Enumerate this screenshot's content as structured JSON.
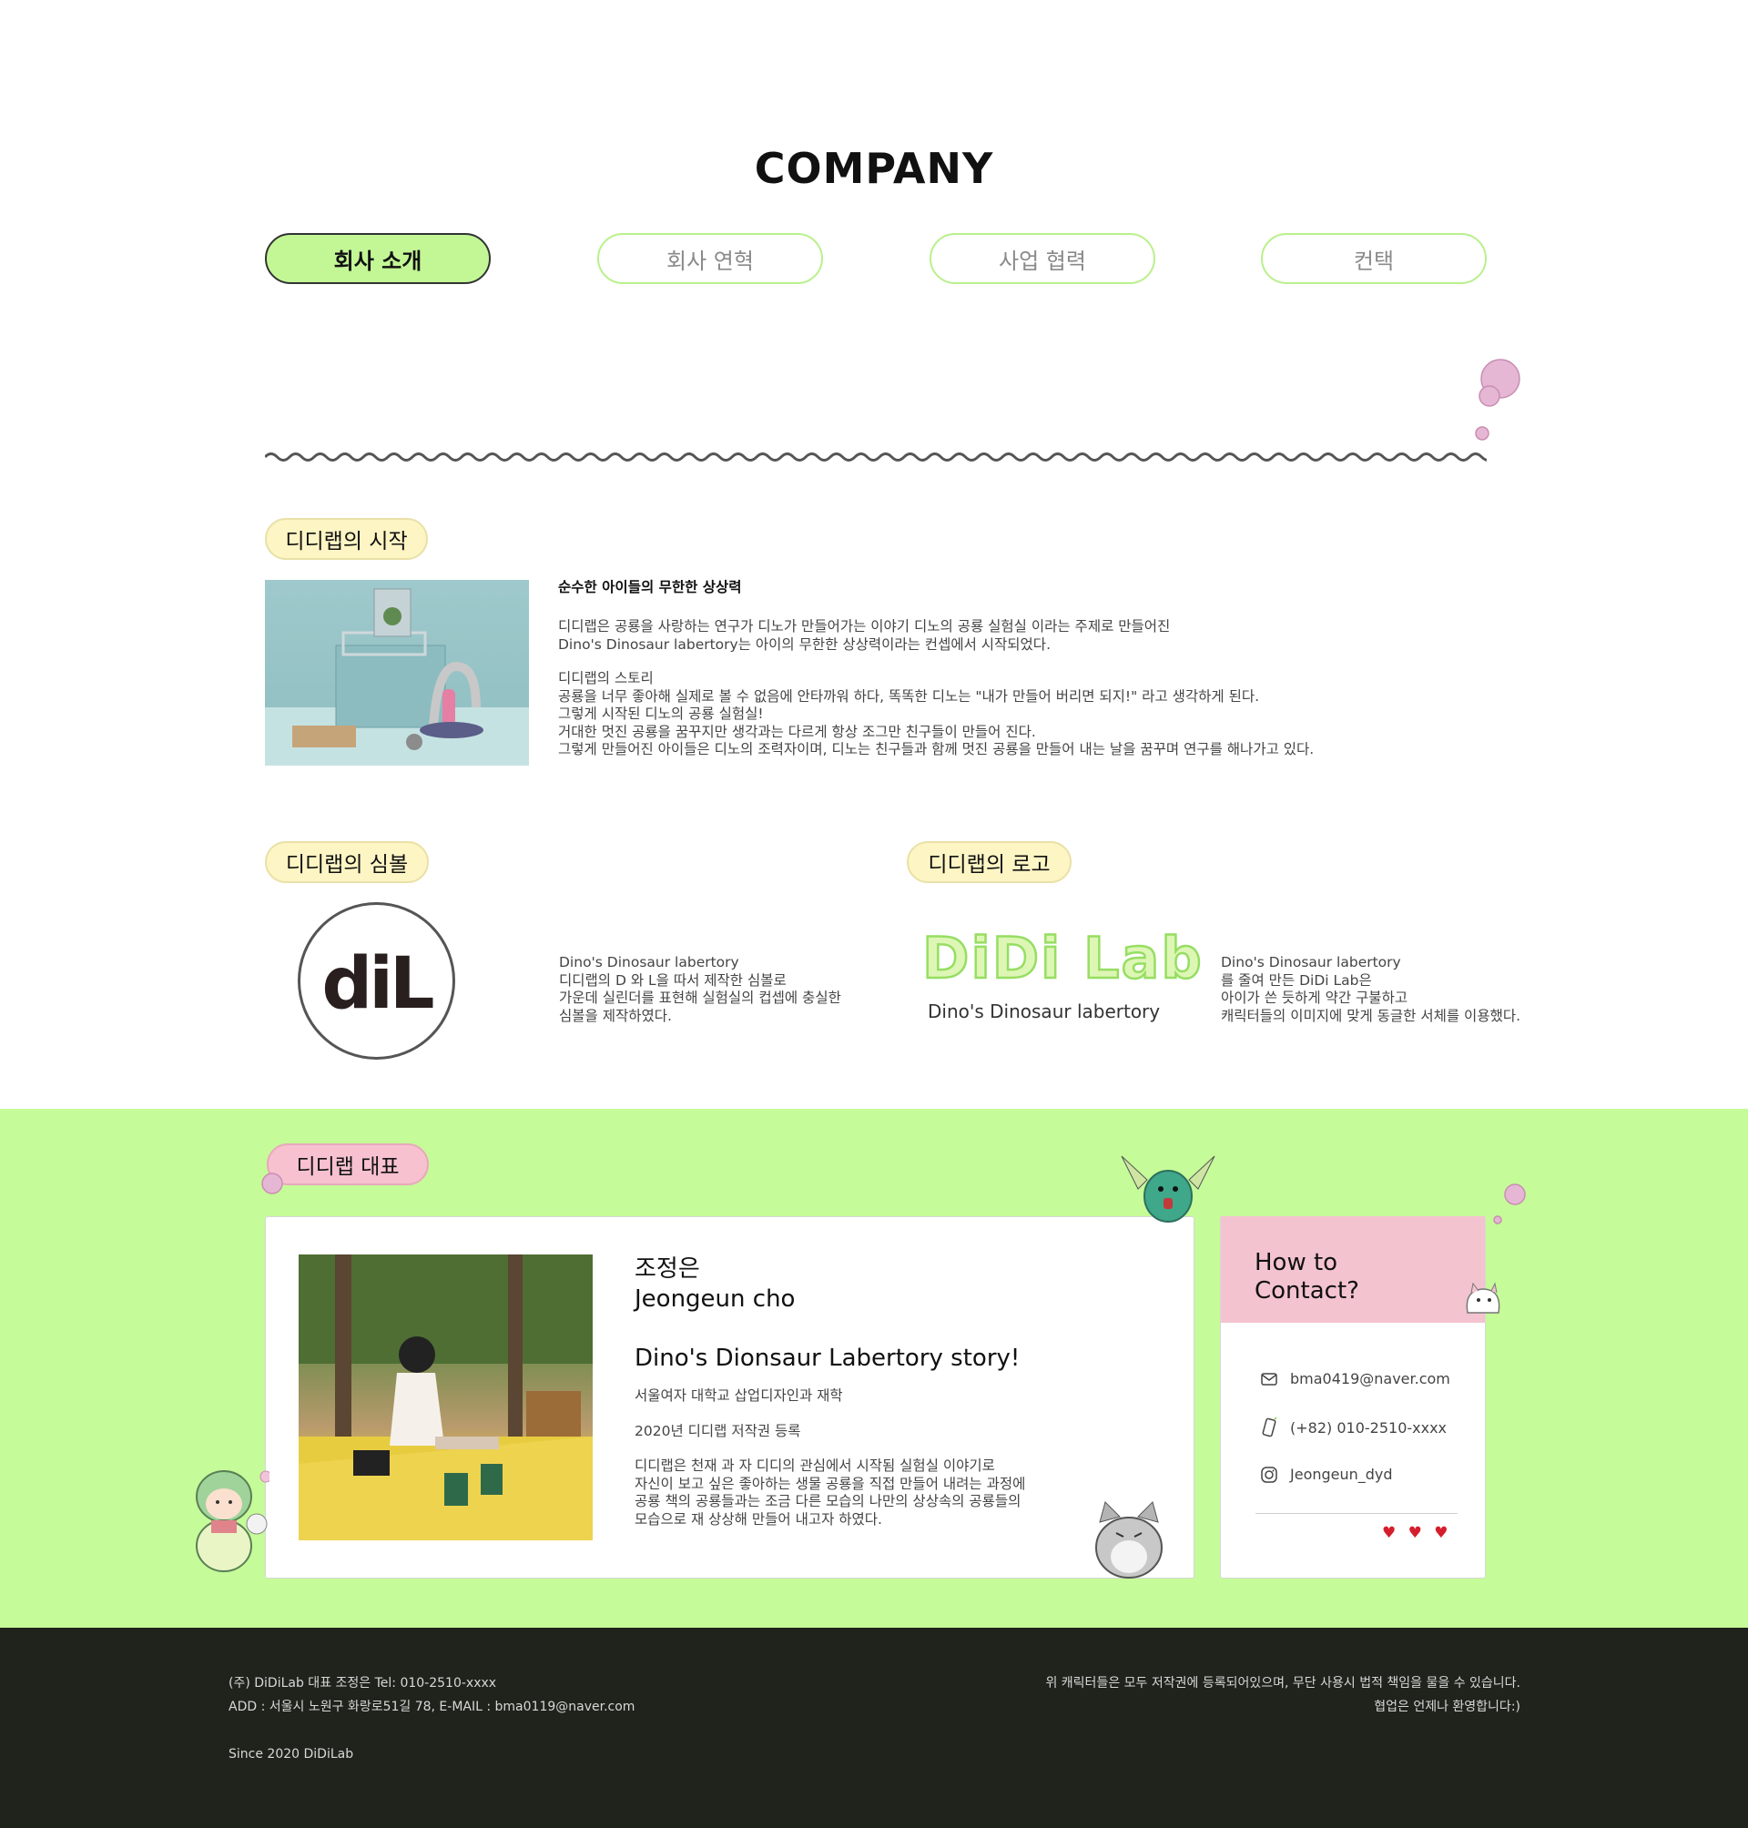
{
  "page": {
    "title": "COMPANY"
  },
  "tabs": [
    {
      "label": "회사 소개",
      "active": true
    },
    {
      "label": "회사 연혁",
      "active": false
    },
    {
      "label": "사업 협력",
      "active": false
    },
    {
      "label": "컨택",
      "active": false
    }
  ],
  "start": {
    "pill": "디디랩의 시작",
    "headline": "순수한 아이들의 무한한 상상력",
    "paragraph1": " 디디랩은 공룡을 사랑하는 연구가 디노가 만들어가는 이야기 디노의 공룡 실험실 이라는 주제로 만들어진\nDino's Dinosaur labertory는 아이의 무한한 상상력이라는 컨셉에서 시작되었다.",
    "paragraph2": "디디랩의 스토리\n 공룡을 너무 좋아해 실제로 볼 수 없음에 안타까워 하다, 똑똑한 디노는 \"내가 만들어 버리면 되지!\" 라고 생각하게 된다.\n그렇게 시작된 디노의 공룡 실험실!\n거대한 멋진 공룡을 꿈꾸지만 생각과는 다르게 항상  조그만 친구들이 만들어 진다.\n그렇게 만들어진 아이들은 디노의 조력자이며, 디노는 친구들과 함께 멋진 공룡을 만들어 내는 날을 꿈꾸며 연구를 해나가고 있다."
  },
  "symbol": {
    "pill": "디디랩의 심볼",
    "mark": "diL",
    "text": "Dino's Dinosaur labertory\n디디랩의 D 와 L을 따서 제작한 심볼로\n가운데 실린더를 표현해 실험실의 컵셉에 충실한\n심볼을 제작하였다."
  },
  "logo": {
    "pill": "디디랩의 로고",
    "wordmark": "DiDi Lab",
    "tagline": "Dino's Dinosaur labertory",
    "text": "Dino's Dinosaur labertory\n를 줄여 만든 DiDi Lab은\n아이가 쓴 듯하게 약간 구불하고\n캐릭터들의 이미지에 맞게 동글한 서체를 이용했다."
  },
  "ceo": {
    "pill": "디디랩 대표",
    "name_ko": "조정은",
    "name_en": "Jeongeun cho",
    "story_title": "Dino's Dionsaur Labertory story!",
    "line1": "서울여자 대학교 삽업디자인과 재학",
    "line2": "2020년 디디랩 저작권 등록",
    "paragraph": "디디랩은 천재 과   자 디디의 관심에서 시작됨 실험실 이야기로\n자신이 보고 싶은 좋아하는 생물 공룡을 직접 만들어 내려는 과정에\n공룡 책의 공룡들과는 조금 다른 모습의 나만의 상상속의 공룡들의\n모습으로 재 상상해 만들어 내고자 하였다."
  },
  "contact": {
    "title": "How to\nContact?",
    "email": "bma0419@naver.com",
    "phone": "(+82) 010-2510-xxxx",
    "instagram": "Jeongeun_dyd",
    "hearts": "♥ ♥ ♥"
  },
  "footer": {
    "line1": "(주) DiDiLab 대표 조정은 Tel: 010-2510-xxxx",
    "line2": "ADD : 서울시 노원구 화랑로51길 78, E-MAIL : bma0119@naver.com",
    "since": "Since 2020 DiDiLab",
    "notice1": "위 캐릭터들은 모두 저작권에 등록되어있으며, 무단 사용시 법적 책임을 물을 수 있습니다.",
    "notice2": "협업은 언제나 환영합니다:)"
  },
  "colors": {
    "accent_green": "#c5fb98",
    "tab_border": "#b9f08c",
    "pill_yellow": "#fdf5c4",
    "pill_pink": "#f7c1d0",
    "footer_bg": "#1f231c"
  }
}
